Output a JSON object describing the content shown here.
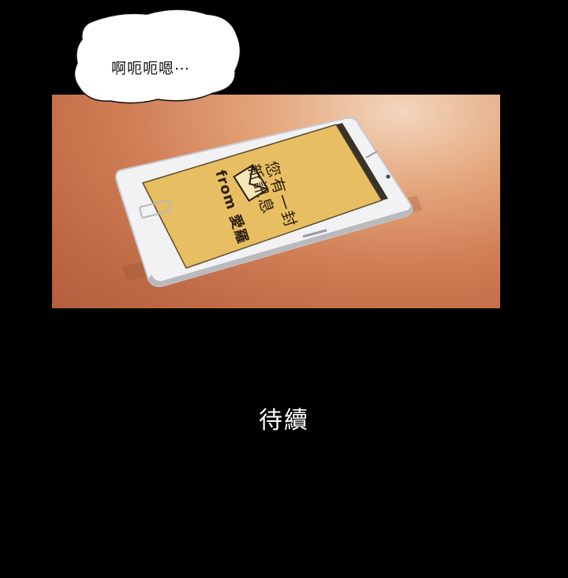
{
  "speech_bubble": {
    "text": "啊呃呃嗯⋯"
  },
  "phone": {
    "notification_line1": "您有一封",
    "notification_line2": "新訊息",
    "notification_line3": "from 愛羅"
  },
  "footer": {
    "to_be_continued": "待續"
  },
  "colors": {
    "background": "#000000",
    "panel_orange": "#c9774f",
    "phone_screen": "#e8be62",
    "bubble_fill": "#ffffff"
  }
}
